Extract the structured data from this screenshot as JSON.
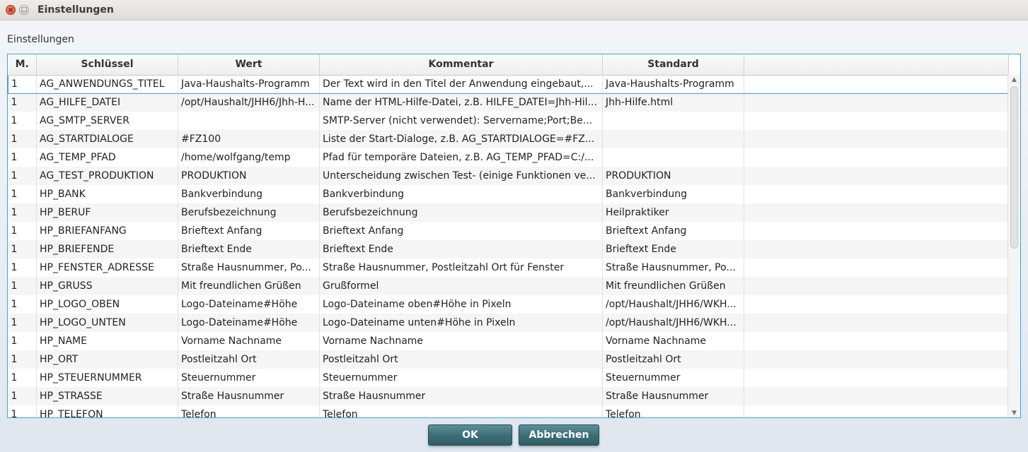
{
  "window": {
    "title": "Einstellungen",
    "close_glyph": "×",
    "max_glyph": "□"
  },
  "section_label": "Einstellungen",
  "table": {
    "columns": [
      "M.",
      "Schlüssel",
      "Wert",
      "Kommentar",
      "Standard",
      ""
    ],
    "rows": [
      [
        "1",
        "AG_ANWENDUNGS_TITEL",
        "Java-Haushalts-Programm",
        "Der Text wird in den Titel der Anwendung eingebaut,...",
        "Java-Haushalts-Programm",
        ""
      ],
      [
        "1",
        "AG_HILFE_DATEI",
        "/opt/Haushalt/JHH6/Jhh-H...",
        "Name der HTML-Hilfe-Datei, z.B. HILFE_DATEI=Jhh-Hil...",
        "Jhh-Hilfe.html",
        ""
      ],
      [
        "1",
        "AG_SMTP_SERVER",
        "",
        "SMTP-Server (nicht verwendet): Servername;Port;Be...",
        "",
        ""
      ],
      [
        "1",
        "AG_STARTDIALOGE",
        "#FZ100",
        "Liste der Start-Dialoge, z.B. AG_STARTDIALOGE=#FZ...",
        "",
        ""
      ],
      [
        "1",
        "AG_TEMP_PFAD",
        "/home/wolfgang/temp",
        "Pfad für temporäre Dateien, z.B. AG_TEMP_PFAD=C:/...",
        "",
        ""
      ],
      [
        "1",
        "AG_TEST_PRODUKTION",
        "PRODUKTION",
        "Unterscheidung zwischen Test- (einige Funktionen ve...",
        "PRODUKTION",
        ""
      ],
      [
        "1",
        "HP_BANK",
        "Bankverbindung",
        "Bankverbindung",
        "Bankverbindung",
        ""
      ],
      [
        "1",
        "HP_BERUF",
        "Berufsbezeichnung",
        "Berufsbezeichnung",
        "Heilpraktiker",
        ""
      ],
      [
        "1",
        "HP_BRIEFANFANG",
        "Brieftext Anfang",
        "Brieftext Anfang",
        "Brieftext Anfang",
        ""
      ],
      [
        "1",
        "HP_BRIEFENDE",
        "Brieftext Ende",
        "Brieftext Ende",
        "Brieftext Ende",
        ""
      ],
      [
        "1",
        "HP_FENSTER_ADRESSE",
        "Straße Hausnummer, Po...",
        "Straße Hausnummer, Postleitzahl Ort für Fenster",
        "Straße Hausnummer, Po...",
        ""
      ],
      [
        "1",
        "HP_GRUSS",
        "Mit freundlichen Grüßen",
        "Grußformel",
        "Mit freundlichen Grüßen",
        ""
      ],
      [
        "1",
        "HP_LOGO_OBEN",
        "Logo-Dateiname#Höhe",
        "Logo-Dateiname oben#Höhe in Pixeln",
        "/opt/Haushalt/JHH6/WKH...",
        ""
      ],
      [
        "1",
        "HP_LOGO_UNTEN",
        "Logo-Dateiname#Höhe",
        "Logo-Dateiname unten#Höhe in Pixeln",
        "/opt/Haushalt/JHH6/WKH...",
        ""
      ],
      [
        "1",
        "HP_NAME",
        "Vorname Nachname",
        "Vorname Nachname",
        "Vorname Nachname",
        ""
      ],
      [
        "1",
        "HP_ORT",
        "Postleitzahl Ort",
        "Postleitzahl Ort",
        "Postleitzahl Ort",
        ""
      ],
      [
        "1",
        "HP_STEUERNUMMER",
        "Steuernummer",
        "Steuernummer",
        "Steuernummer",
        ""
      ],
      [
        "1",
        "HP_STRASSE",
        "Straße Hausnummer",
        "Straße Hausnummer",
        "Straße Hausnummer",
        ""
      ],
      [
        "1",
        "HP_TELEFON",
        "Telefon",
        "Telefon",
        "Telefon",
        ""
      ]
    ]
  },
  "scrollbar": {
    "up_glyph": "▲",
    "down_glyph": "▼"
  },
  "buttons": {
    "ok": "OK",
    "cancel": "Abbrechen"
  }
}
